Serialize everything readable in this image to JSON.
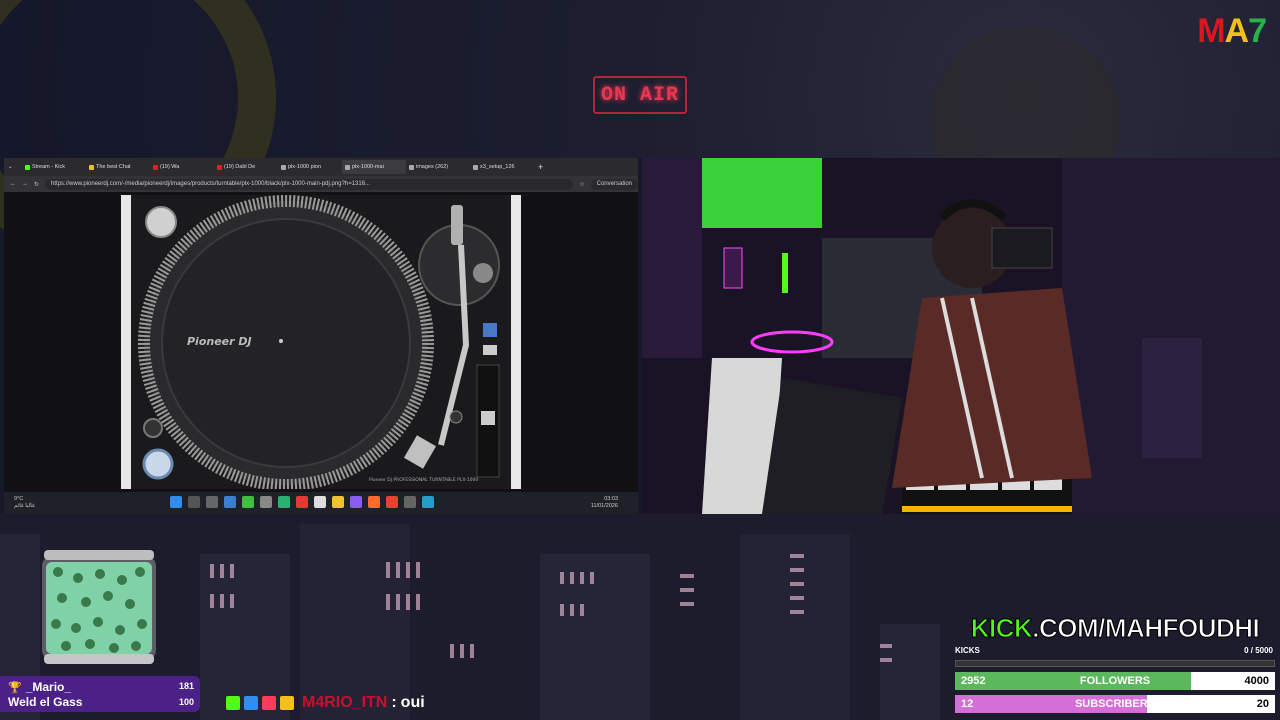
{
  "overlay": {
    "logo": {
      "m": "M",
      "a": "A",
      "s": "7"
    },
    "on_air": "ON AIR"
  },
  "browser": {
    "tabs": [
      "Stream - Kick",
      "The best Chat",
      "(19) Wa",
      "(19) Dabl De",
      "plx-1000 pion",
      "plx-1000-mai",
      "images (262)",
      "x3_setup_126"
    ],
    "url": "https://www.pioneerdj.com/-/media/pioneerdj/images/products/turntable/plx-1000/black/plx-1000-main-pdj.png?h=1316...",
    "conversation_label": "Conversation",
    "turntable": {
      "brand": "Pioneer DJ",
      "model": "PLX-1000",
      "caption": "Pioneer Dj   PROFESSIONAL TURNTABLE   PLX-1000"
    },
    "taskbar": {
      "temp": "9°C",
      "weather_text": "غالبا غائم",
      "time": "03:03",
      "date": "11/01/2026"
    }
  },
  "alert": {
    "name": "_Mario_",
    "message": "Weld el Gass",
    "value1": "181",
    "value2": "100"
  },
  "chat": {
    "user": "M4RIO_ITN",
    "sep": ":",
    "message": "oui"
  },
  "kick": {
    "logo_green": "KICK",
    "logo_white": ".COM/MAHFOUDHI",
    "kicks_label": "KICKS",
    "kicks_value": "0  /  5000",
    "kicks_progress": 0,
    "followers": {
      "current": "2952",
      "label": "FOLLOWERS",
      "goal": "4000",
      "progress": 0.738,
      "color": "#5cb85c"
    },
    "subscribers": {
      "current": "12",
      "label": "SUBSCRIBERS",
      "goal": "20",
      "progress": 0.6,
      "color": "#d36fd6"
    }
  }
}
